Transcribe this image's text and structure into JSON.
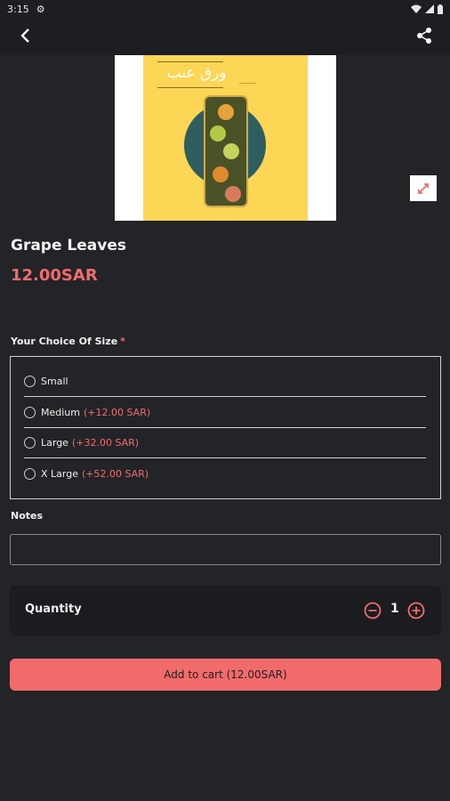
{
  "status": {
    "time": "3:15"
  },
  "product": {
    "image_text_arabic": "ورق عنب",
    "title": "Grape Leaves",
    "price": "12.00SAR"
  },
  "size": {
    "label": "Your Choice Of Size",
    "required_marker": "*",
    "options": [
      {
        "name": "Small",
        "extra": ""
      },
      {
        "name": "Medium",
        "extra": "(+12.00 SAR)"
      },
      {
        "name": "Large",
        "extra": "(+32.00 SAR)"
      },
      {
        "name": "X Large",
        "extra": "(+52.00 SAR)"
      }
    ]
  },
  "notes": {
    "label": "Notes",
    "value": ""
  },
  "quantity": {
    "label": "Quantity",
    "value": "1"
  },
  "cart": {
    "button_label": "Add to cart (12.00SAR)"
  },
  "colors": {
    "accent": "#f26b6b",
    "background": "#232428",
    "card": "#1b1c1f"
  }
}
